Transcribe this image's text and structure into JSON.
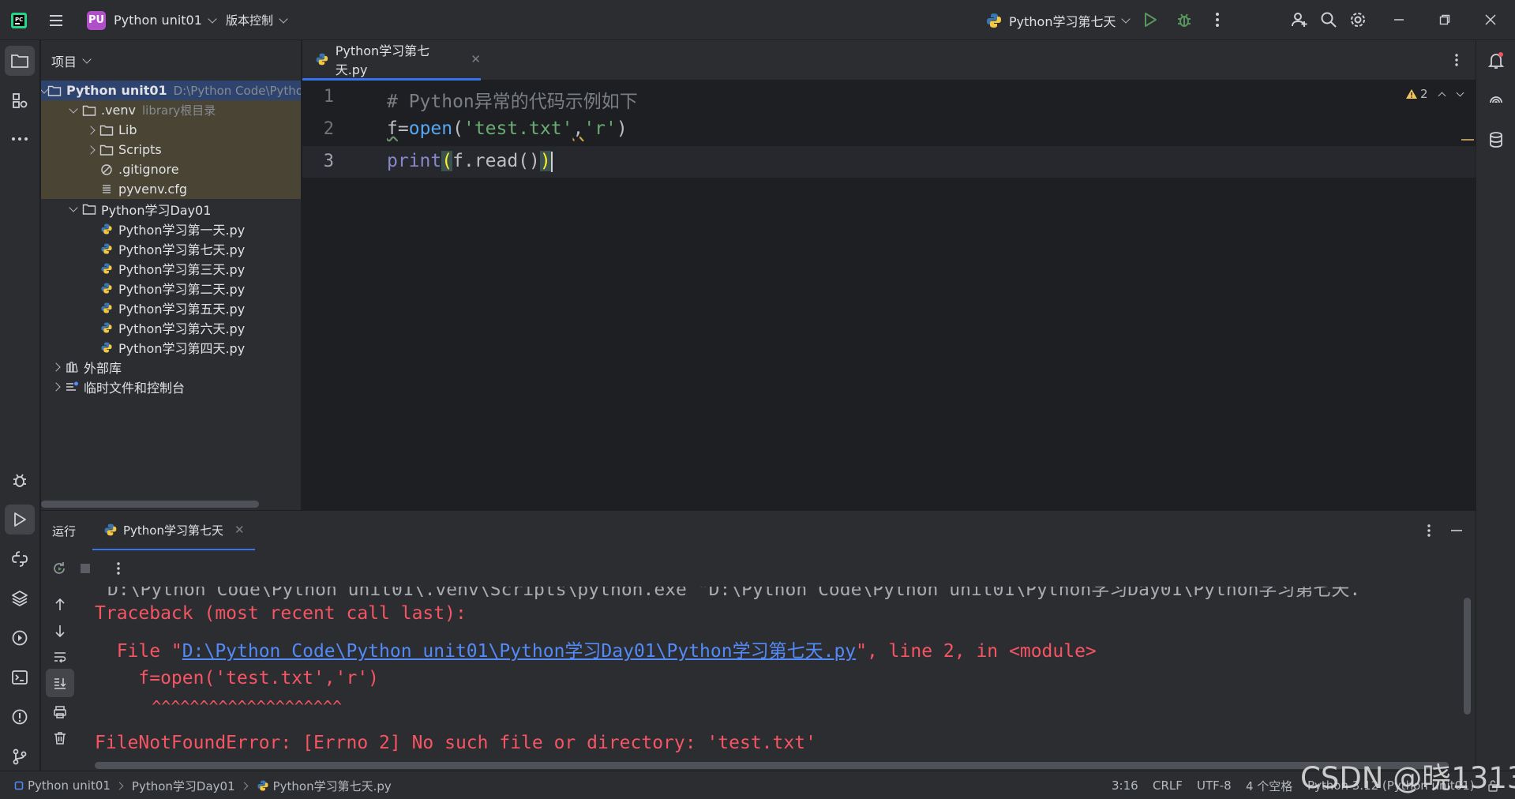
{
  "titlebar": {
    "project_badge": "PU",
    "project_name": "Python unit01",
    "vcs_menu": "版本控制",
    "run_config": "Python学习第七天",
    "window_controls": [
      "minimize-icon",
      "restore-icon",
      "close-icon"
    ]
  },
  "project_panel": {
    "title": "项目",
    "tree": [
      {
        "label": "Python unit01",
        "hint": "D:\\Python Code\\Pytho",
        "icon": "folder-icon",
        "expanded": true
      },
      {
        "label": ".venv",
        "hint": "library根目录",
        "icon": "folder-icon",
        "expanded": true
      },
      {
        "label": "Lib",
        "icon": "folder-icon",
        "expanded": false
      },
      {
        "label": "Scripts",
        "icon": "folder-icon",
        "expanded": false
      },
      {
        "label": ".gitignore",
        "icon": "ignore-file-icon"
      },
      {
        "label": "pyvenv.cfg",
        "icon": "config-file-icon"
      },
      {
        "label": "Python学习Day01",
        "icon": "folder-icon",
        "expanded": true
      },
      {
        "label": "Python学习第一天.py",
        "icon": "python-file-icon"
      },
      {
        "label": "Python学习第七天.py",
        "icon": "python-file-icon"
      },
      {
        "label": "Python学习第三天.py",
        "icon": "python-file-icon"
      },
      {
        "label": "Python学习第二天.py",
        "icon": "python-file-icon"
      },
      {
        "label": "Python学习第五天.py",
        "icon": "python-file-icon"
      },
      {
        "label": "Python学习第六天.py",
        "icon": "python-file-icon"
      },
      {
        "label": "Python学习第四天.py",
        "icon": "python-file-icon"
      },
      {
        "label": "外部库",
        "icon": "library-icon",
        "expanded": false
      },
      {
        "label": "临时文件和控制台",
        "icon": "scratches-icon",
        "expanded": false
      }
    ]
  },
  "editor": {
    "tab": "Python学习第七天.py",
    "warnings": "2",
    "line_numbers": [
      "1",
      "2",
      "3"
    ],
    "code": {
      "line1_comment": "# Python异常的代码示例如下",
      "line2_a": "f",
      "line2_b": "=",
      "line2_func": "open",
      "line2_c": "(",
      "line2_str1": "'test.txt'",
      "line2_d": ",",
      "line2_str2": "'r'",
      "line2_e": ")",
      "line3_builtin": "print",
      "line3_open": "(",
      "line3_mid": "f.read()",
      "line3_close": ")"
    }
  },
  "run_panel": {
    "label": "运行",
    "tab": "Python学习第七天",
    "console": {
      "cmd": "D:\\Python Code\\Python unit01\\.venv\\Scripts\\python.exe \"D:\\Python Code\\Python unit01\\Python学习Day01\\Python学习第七天.",
      "traceback": "Traceback (most recent call last):",
      "file_prefix": "  File \"",
      "file_link": "D:\\Python Code\\Python unit01\\Python学习Day01\\Python学习第七天.py",
      "file_suffix": "\", line 2, in <module>",
      "code": "    f=open('test.txt','r')",
      "carets": "      ^^^^^^^^^^^^^^^^^^^^",
      "error": "FileNotFoundError: [Errno 2] No such file or directory: 'test.txt'"
    }
  },
  "statusbar": {
    "breadcrumb": [
      "Python unit01",
      "Python学习Day01",
      "Python学习第七天.py"
    ],
    "position": "3:16",
    "line_sep": "CRLF",
    "encoding": "UTF-8",
    "indent": "4 个空格",
    "interpreter": "Python 3.12 (Python unit01)"
  },
  "watermark": "CSDN @晓1313",
  "colors": {
    "accent": "#3574f0",
    "error": "#f75464",
    "string": "#6aab73",
    "function": "#56a8f5"
  }
}
